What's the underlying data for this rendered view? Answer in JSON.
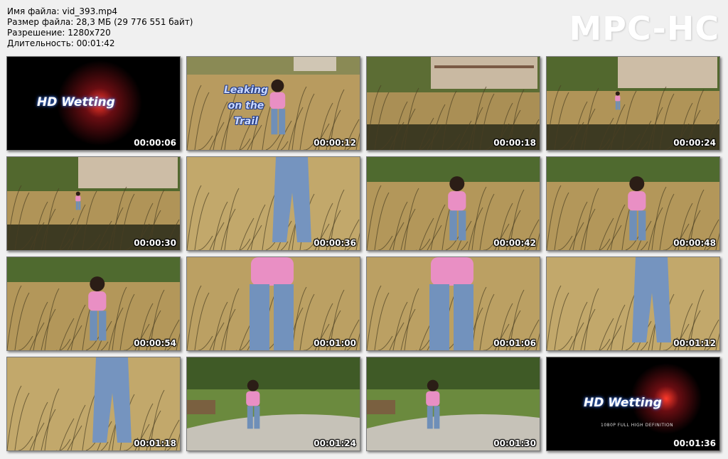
{
  "info": {
    "filename": "Имя файла: vid_393.mp4",
    "filesize": "Размер файла: 28,3 МБ (29 776 551 байт)",
    "resolution": "Разрешение: 1280x720",
    "duration": "Длительность: 00:01:42"
  },
  "logo": "MPC-HC",
  "overlay": {
    "hd_title": "HD Wetting",
    "leaking_line1": "Leaking",
    "leaking_line2": "on the",
    "leaking_line3": "Trail",
    "subtitle": "1080P FULL HIGH DEFINITION"
  },
  "thumbnails": [
    {
      "time": "00:00:06",
      "scene": "title"
    },
    {
      "time": "00:00:12",
      "scene": "field-woman-title"
    },
    {
      "time": "00:00:18",
      "scene": "field-building"
    },
    {
      "time": "00:00:24",
      "scene": "field-building-far"
    },
    {
      "time": "00:00:30",
      "scene": "field-building-far"
    },
    {
      "time": "00:00:36",
      "scene": "closeup-jeans"
    },
    {
      "time": "00:00:42",
      "scene": "field-woman"
    },
    {
      "time": "00:00:48",
      "scene": "field-woman"
    },
    {
      "time": "00:00:54",
      "scene": "field-woman"
    },
    {
      "time": "00:01:00",
      "scene": "closeup-torso"
    },
    {
      "time": "00:01:06",
      "scene": "closeup-torso"
    },
    {
      "time": "00:01:12",
      "scene": "closeup-jeans"
    },
    {
      "time": "00:01:18",
      "scene": "closeup-jeans"
    },
    {
      "time": "00:01:24",
      "scene": "park-path"
    },
    {
      "time": "00:01:30",
      "scene": "park-path"
    },
    {
      "time": "00:01:36",
      "scene": "title-end"
    }
  ]
}
